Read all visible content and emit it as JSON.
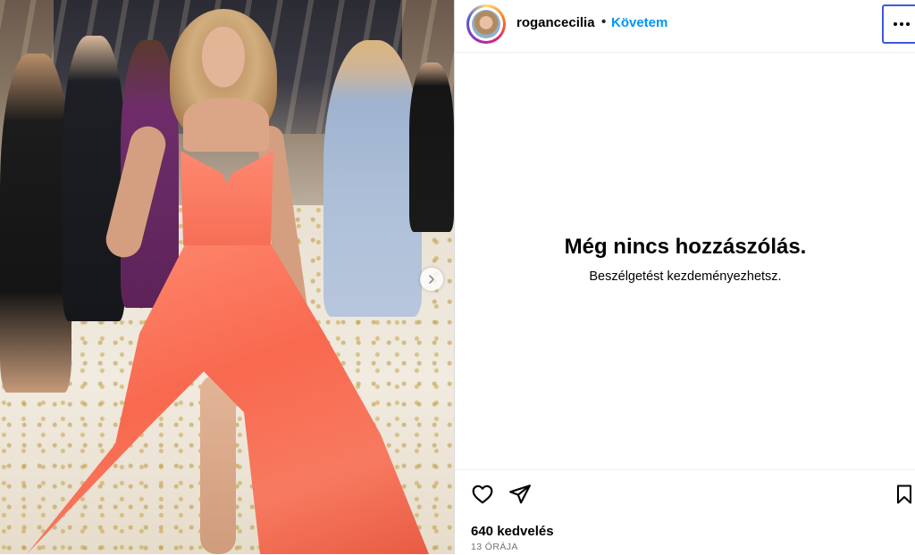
{
  "post": {
    "author": "rogancecilia",
    "separator": "•",
    "follow_label": "Követem",
    "more_icon": "more-horizontal-icon",
    "photo_alt": "Photo of a woman in a coral strapless high-low gown at an event"
  },
  "comments": {
    "empty_title": "Még nincs hozzászólás.",
    "empty_subtitle": "Beszélgetést kezdeményezhetsz."
  },
  "actions": {
    "like_icon": "heart-icon",
    "share_icon": "paper-plane-icon",
    "save_icon": "bookmark-icon",
    "likes_text": "640 kedvelés",
    "time_text": "13 ÓRÁJA"
  },
  "colors": {
    "follow_blue": "#0095f6",
    "dress_coral": "#f8694f",
    "focus_outline": "#3b5bdb"
  }
}
